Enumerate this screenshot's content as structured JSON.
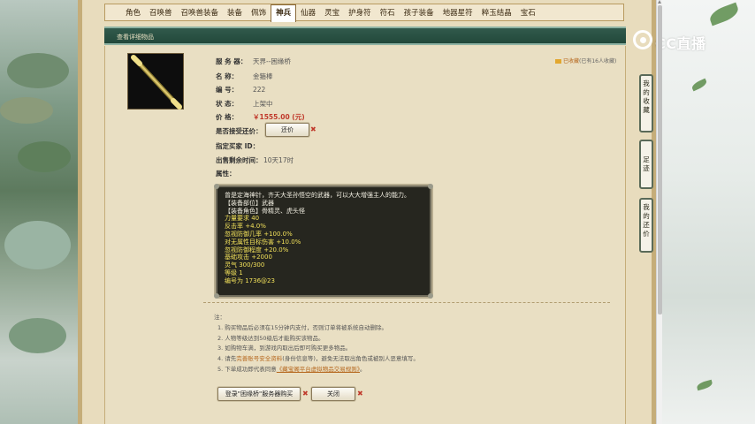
{
  "tabs": [
    "角色",
    "召唤兽",
    "召唤兽装备",
    "装备",
    "佩饰",
    "神兵",
    "仙器",
    "灵宝",
    "护身符",
    "符石",
    "孩子装备",
    "地器星符",
    "粹玉结晶",
    "宝石"
  ],
  "active_tab": "神兵",
  "section_title": "查看详细物品",
  "favorite": {
    "link": "已收藏",
    "count_text": "(已有16人收藏)"
  },
  "details": {
    "server_label": "服 务 器：",
    "server_value": "天界--困缘桥",
    "name_label": "名          称：",
    "name_value": "金箍棒",
    "id_label": "编          号：",
    "id_value": "222",
    "status_label": "状          态：",
    "status_value": "上架中",
    "price_label": "价          格：",
    "price_value": "￥1555.00 (元)",
    "bargain_label": "是否接受还价：",
    "bargain_button": "还价",
    "buyer_label": "指定买家 ID：",
    "time_label": "出售剩余时间：",
    "time_value": "10天17时",
    "attr_label": "属性："
  },
  "props": [
    {
      "text": "曾是定海神针，齐天大圣孙悟空的武器，可以大大增强主人的能力。",
      "color": "white"
    },
    {
      "text": "【装备部位】武器",
      "color": "white"
    },
    {
      "text": "【装备角色】骨精灵、虎头怪",
      "color": "white"
    },
    {
      "text": "力量要求 40",
      "color": "yellow"
    },
    {
      "text": "反击率 +4.0%",
      "color": "yellow"
    },
    {
      "text": "忽视防御几率 +100.0%",
      "color": "yellow"
    },
    {
      "text": "对无属性目标伤害 +10.0%",
      "color": "yellow"
    },
    {
      "text": "忽视防御程度 +20.0%",
      "color": "yellow"
    },
    {
      "text": "基础攻击 +2000",
      "color": "yellow"
    },
    {
      "text": "灵气 300/300",
      "color": "yellow"
    },
    {
      "text": "等级 1",
      "color": "yellow"
    },
    {
      "text": "编号为 1736@23",
      "color": "yellow"
    }
  ],
  "notes": {
    "title": "注：",
    "n1": "1. 购买物品后必须在15分钟内支付，否则订单将被系统自动删除。",
    "n2": "2. 人物等级达到50级后才能购买该物品。",
    "n3": "3. 如购物车满，到游戏内取出后即可购买更多物品。",
    "n4a": "4. 请先",
    "n4link": "完善账号安全资料",
    "n4b": "(身份信息等)，避免无法取出角色或被别人恶意填写。",
    "n5a": "5. 下单成功即代表同意",
    "n5link": "《藏宝阁平台虚拟物品交易规则》",
    "n5b": "。"
  },
  "buttons": {
    "login": "登录\"困缘桥\"服务器购买",
    "close": "关闭"
  },
  "side_tabs": [
    "我的收藏",
    "足迹",
    "我的还价"
  ],
  "logo_text": "CC直播"
}
